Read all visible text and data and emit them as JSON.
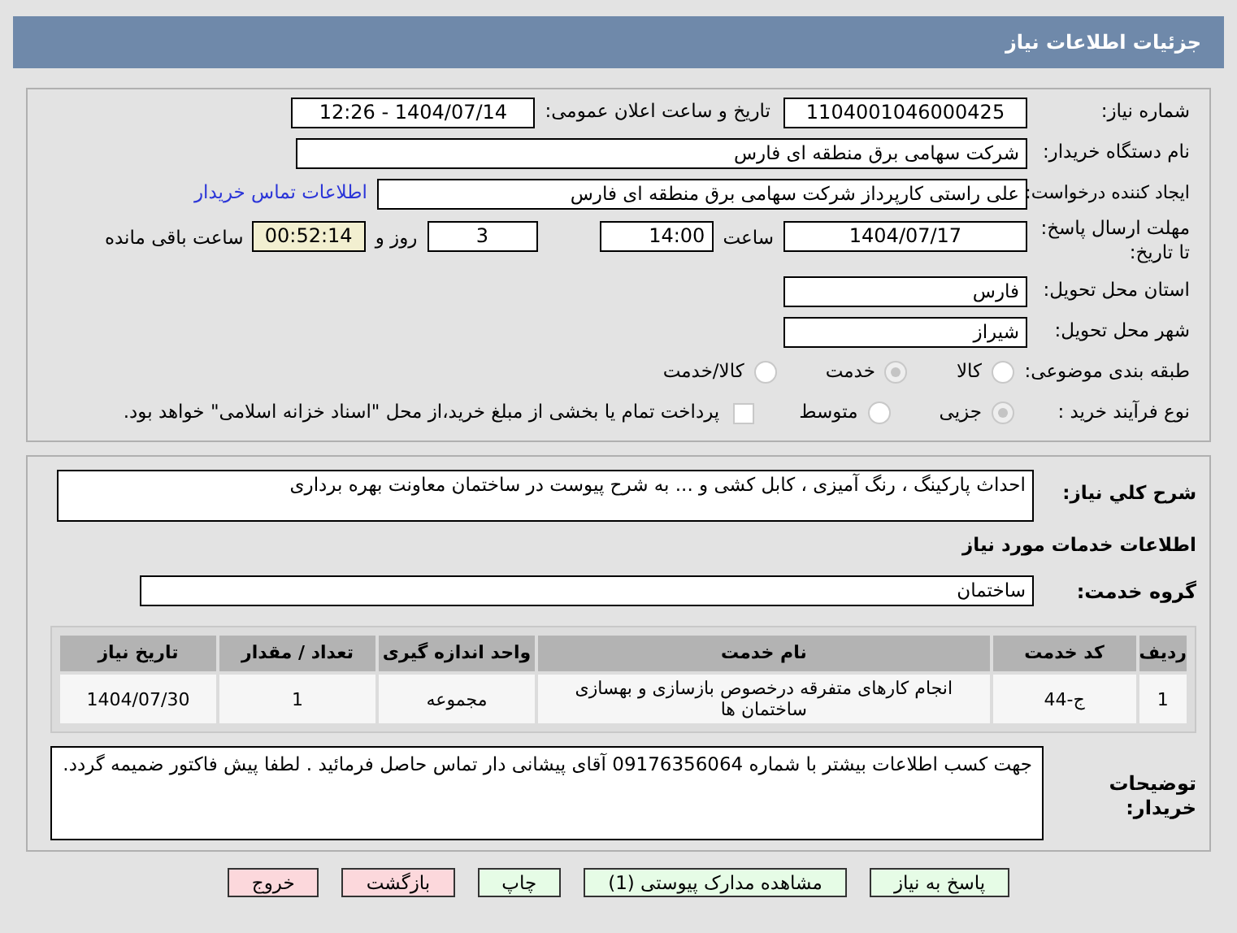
{
  "header": {
    "title": "جزئیات اطلاعات نیاز"
  },
  "need_number": {
    "label": "شماره نیاز:",
    "value": "1104001046000425"
  },
  "announce": {
    "label": "تاریخ و ساعت اعلان عمومی:",
    "value": "1404/07/14 - 12:26"
  },
  "buyer_org": {
    "label": "نام دستگاه خریدار:",
    "value": "شرکت سهامی برق منطقه ای فارس"
  },
  "requester": {
    "label": "ایجاد کننده درخواست:",
    "value": "علی راستی کارپرداز شرکت سهامی برق منطقه ای فارس",
    "link": "اطلاعات تماس خریدار"
  },
  "deadline": {
    "label": "مهلت ارسال پاسخ: تا تاریخ:",
    "date": "1404/07/17",
    "time_label": "ساعت",
    "time": "14:00",
    "days": "3",
    "days_label": "روز و",
    "remaining": "00:52:14",
    "remaining_label": "ساعت باقی مانده"
  },
  "province": {
    "label": "استان محل تحویل:",
    "value": "فارس"
  },
  "city": {
    "label": "شهر محل تحویل:",
    "value": "شیراز"
  },
  "category": {
    "label": "طبقه بندی موضوعی:",
    "options": [
      {
        "label": "کالا",
        "selected": false
      },
      {
        "label": "خدمت",
        "selected": true
      },
      {
        "label": "کالا/خدمت",
        "selected": false
      }
    ]
  },
  "process": {
    "label": "نوع فرآیند خرید :",
    "options": [
      {
        "label": "جزیی",
        "selected": true
      },
      {
        "label": "متوسط",
        "selected": false
      }
    ],
    "payment": {
      "checked": false,
      "label": "پرداخت تمام یا بخشی از مبلغ خرید،از محل \"اسناد خزانه اسلامی\" خواهد بود."
    }
  },
  "description": {
    "label": "شرح کلي نياز:",
    "value": "احداث پارکینگ ، رنگ آمیزی ، کابل کشی و ... به شرح پیوست در ساختمان معاونت بهره برداری"
  },
  "services_title": "اطلاعات خدمات مورد نیاز",
  "service_group": {
    "label": "گروه خدمت:",
    "value": "ساختمان"
  },
  "table": {
    "columns": [
      "ردیف",
      "کد خدمت",
      "نام خدمت",
      "واحد اندازه گیری",
      "تعداد / مقدار",
      "تاریخ نیاز"
    ],
    "rows": [
      [
        "1",
        "ج-44",
        "انجام کارهای متفرقه درخصوص بازسازی و بهسازی ساختمان ها",
        "مجموعه",
        "1",
        "1404/07/30"
      ]
    ]
  },
  "buyer_notes": {
    "label": "توضیحات خریدار:",
    "value": "جهت کسب اطلاعات بیشتر با شماره 09176356064 آقای پیشانی دار تماس حاصل فرمائید . لطفا پیش فاکتور ضمیمه گردد."
  },
  "buttons": [
    {
      "label": "پاسخ به نیاز",
      "kind": "green"
    },
    {
      "label": "مشاهده مدارک پیوستی (1)",
      "kind": "green"
    },
    {
      "label": "چاپ",
      "kind": "green"
    },
    {
      "label": "بازگشت",
      "kind": "red"
    },
    {
      "label": "خروج",
      "kind": "red"
    }
  ]
}
